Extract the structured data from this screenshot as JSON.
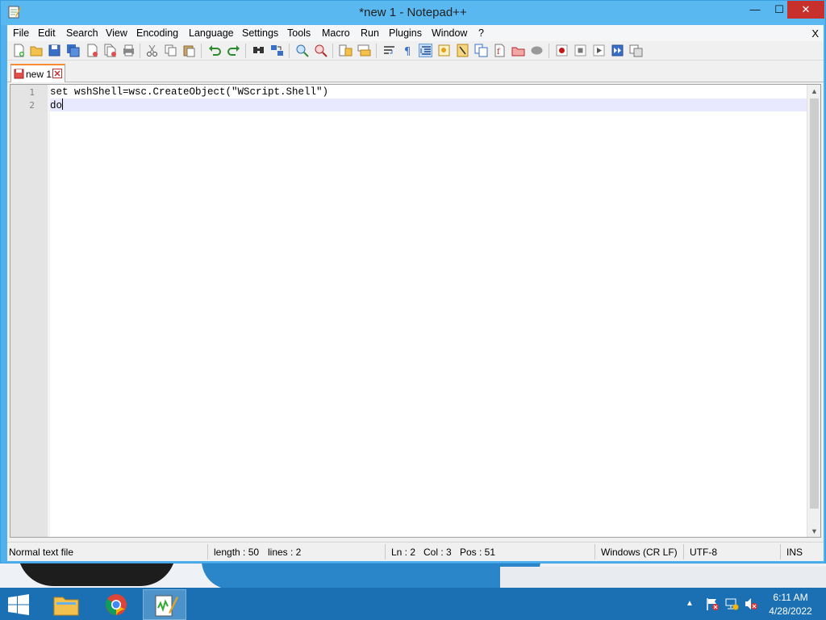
{
  "window": {
    "title": "*new 1 - Notepad++",
    "minimize": "—",
    "maximize": "☐",
    "close": "✕"
  },
  "menu": {
    "items": [
      "File",
      "Edit",
      "Search",
      "View",
      "Encoding",
      "Language",
      "Settings",
      "Tools",
      "Macro",
      "Run",
      "Plugins",
      "Window",
      "?"
    ],
    "close_doc": "X"
  },
  "toolbar": {
    "icons": [
      "new-file-icon",
      "open-file-icon",
      "save-icon",
      "save-all-icon",
      "close-icon",
      "close-all-icon",
      "print-icon",
      "cut-icon",
      "copy-icon",
      "paste-icon",
      "undo-icon",
      "redo-icon",
      "find-icon",
      "replace-icon",
      "zoom-in-icon",
      "zoom-out-icon",
      "sync-vertical-icon",
      "sync-horizontal-icon",
      "word-wrap-icon",
      "show-all-chars-icon",
      "indent-guide-icon",
      "user-lang-icon",
      "doc-map-icon",
      "function-list-icon",
      "folder-workspace-icon",
      "monitoring-icon",
      "start-recording-icon",
      "stop-recording-icon",
      "playback-icon",
      "run-macro-multiple-icon",
      "save-macro-icon"
    ]
  },
  "tabs": [
    {
      "label": "new 1",
      "active": true
    }
  ],
  "editor": {
    "lines": [
      {
        "number": "1",
        "text": "set wshShell=wsc.CreateObject(\"WScript.Shell\")"
      },
      {
        "number": "2",
        "text": "do"
      }
    ],
    "current_line": 2
  },
  "status": {
    "file_type": "Normal text file",
    "length": "length : 50",
    "lines": "lines : 2",
    "ln": "Ln : 2",
    "col": "Col : 3",
    "pos": "Pos : 51",
    "eol": "Windows (CR LF)",
    "encoding": "UTF-8",
    "mode": "INS"
  },
  "taskbar": {
    "apps": [
      "file-explorer-icon",
      "chrome-icon",
      "notepad-plus-plus-icon"
    ],
    "time": "6:11 AM",
    "date": "4/28/2022",
    "tray_toggle": "▲"
  },
  "colors": {
    "title_bar": "#59b8f0",
    "close_button": "#c7302b",
    "tab_accent": "#fa8a2e",
    "current_line": "#e8e8ff",
    "taskbar": "#1b6fb3"
  }
}
